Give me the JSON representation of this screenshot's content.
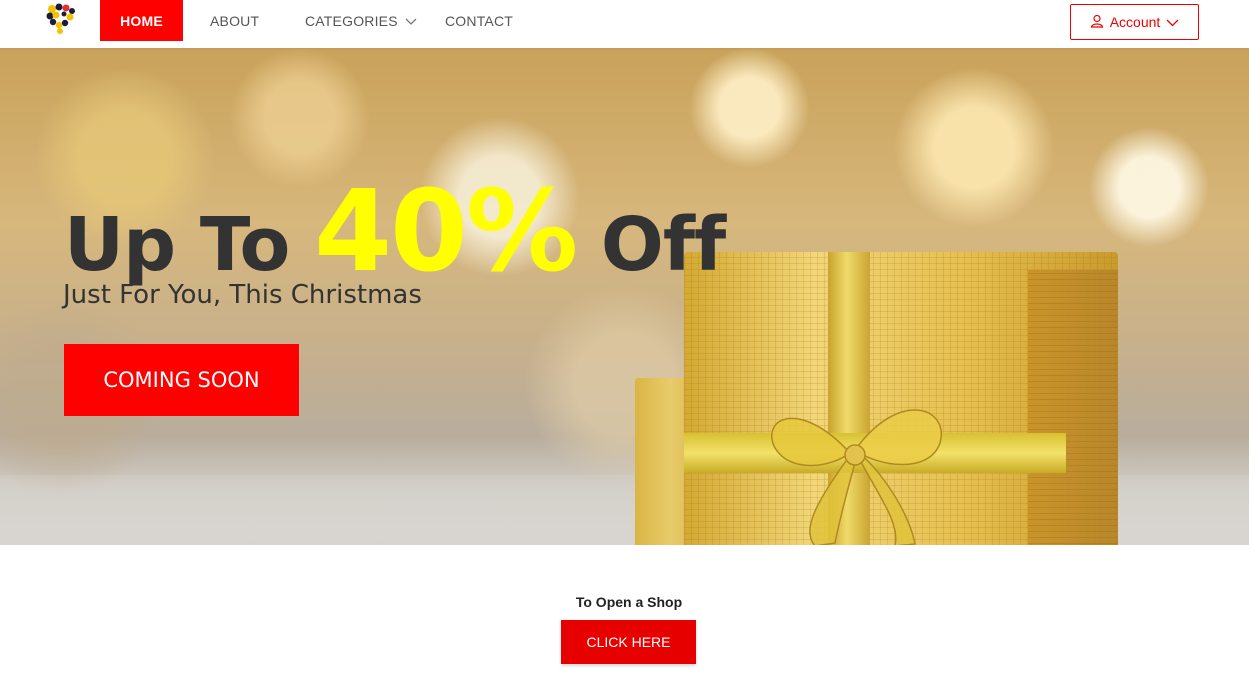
{
  "nav": {
    "home": "HOME",
    "about": "ABOUT",
    "categories": "CATEGORIES",
    "contact": "CONTACT",
    "account": "Account",
    "accent_color": "#ff0000"
  },
  "icons": {
    "logo": "brand-logo",
    "categories_chevron": "chevron-down-icon",
    "account_user": "user-icon",
    "account_chevron": "chevron-down-icon"
  },
  "hero": {
    "title_prefix": "Up To",
    "title_highlight": "40%",
    "title_suffix": "Off",
    "subtitle": "Just For You, This Christmas",
    "cta": "COMING SOON",
    "highlight_color": "#ffff00"
  },
  "shop": {
    "label": "To Open a Shop",
    "button": "CLICK HERE"
  }
}
